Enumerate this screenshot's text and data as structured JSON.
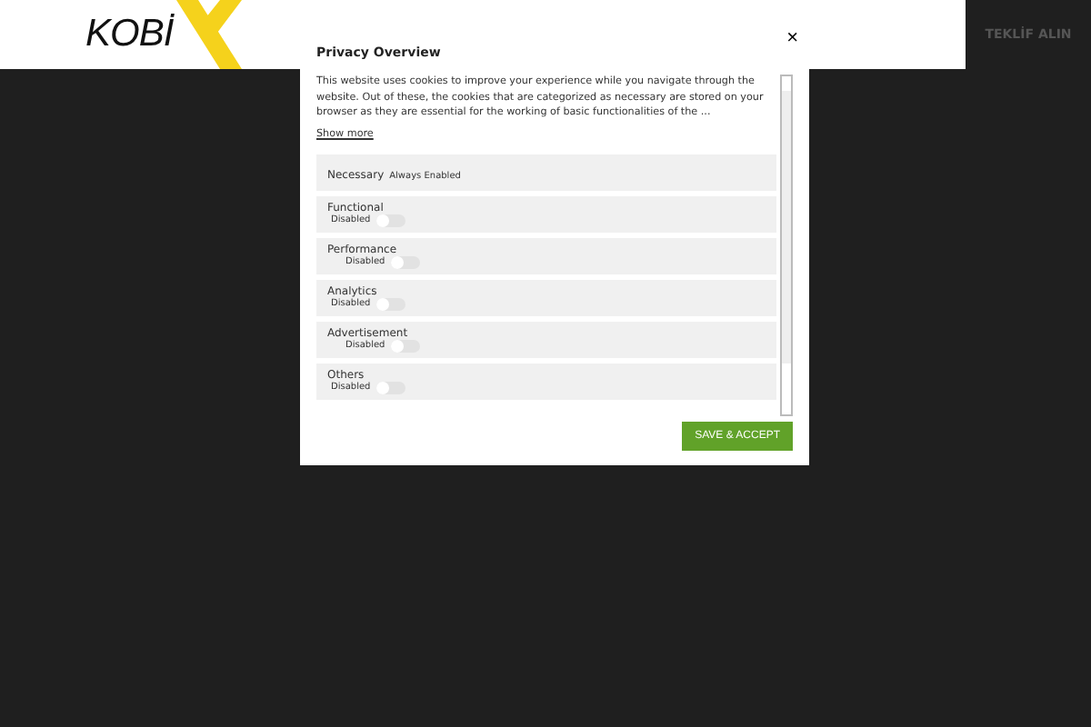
{
  "header": {
    "logo_text": "KOBİ",
    "cta": "TEKLİF ALIN"
  },
  "modal": {
    "close": "×",
    "title": "Privacy Overview",
    "description": "This website uses cookies to improve your experience while you navigate through the website. Out of these, the cookies that are categorized as necessary are stored on your browser as they are essential for the working of basic functionalities of the ...",
    "show_more": "Show more",
    "categories": [
      {
        "kind": "fixed",
        "name": "Necessary",
        "status": "Always Enabled"
      },
      {
        "kind": "toggle",
        "name": "Functional",
        "status": "Disabled",
        "on": false
      },
      {
        "kind": "toggle",
        "name": "Performance",
        "status": "Disabled",
        "on": false
      },
      {
        "kind": "toggle",
        "name": "Analytics",
        "status": "Disabled",
        "on": false
      },
      {
        "kind": "toggle",
        "name": "Advertisement",
        "status": "Disabled",
        "on": false
      },
      {
        "kind": "toggle",
        "name": "Others",
        "status": "Disabled",
        "on": false
      }
    ],
    "save_button": "SAVE & ACCEPT"
  }
}
